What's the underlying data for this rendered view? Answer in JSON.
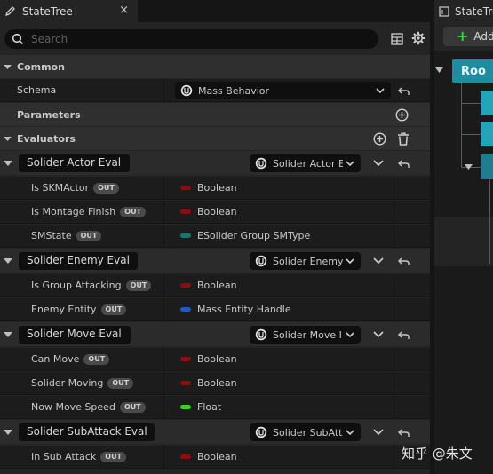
{
  "tab": {
    "title": "StateTree",
    "close": "×"
  },
  "search": {
    "placeholder": "Search"
  },
  "categories": {
    "common": "Common",
    "parameters": "Parameters",
    "evaluators": "Evaluators"
  },
  "schema": {
    "label": "Schema",
    "value": "Mass Behavior"
  },
  "evaluators": [
    {
      "name": "Solider Actor Eval",
      "class": "Solider Actor E",
      "props": [
        {
          "name": "Is SKMActor",
          "badge": "OUT",
          "type": "Boolean",
          "color": "#8b0d0d"
        },
        {
          "name": "Is Montage Finish",
          "badge": "OUT",
          "type": "Boolean",
          "color": "#8b0d0d"
        },
        {
          "name": "SMState",
          "badge": "OUT",
          "type": "ESolider Group SMType",
          "color": "#0c7a6f"
        }
      ]
    },
    {
      "name": "Solider Enemy Eval",
      "class": "Solider Enemy",
      "props": [
        {
          "name": "Is Group Attacking",
          "badge": "OUT",
          "type": "Boolean",
          "color": "#8b0d0d"
        },
        {
          "name": "Enemy Entity",
          "badge": "OUT",
          "type": "Mass Entity Handle",
          "color": "#1f59c4"
        }
      ]
    },
    {
      "name": "Solider Move Eval",
      "class": "Solider Move I",
      "props": [
        {
          "name": "Can Move",
          "badge": "OUT",
          "type": "Boolean",
          "color": "#8b0d0d"
        },
        {
          "name": "Solider Moving",
          "badge": "OUT",
          "type": "Boolean",
          "color": "#8b0d0d"
        },
        {
          "name": "Now Move Speed",
          "badge": "OUT",
          "type": "Float",
          "color": "#3ed321"
        }
      ]
    },
    {
      "name": "Solider SubAttack Eval",
      "class": "Solider SubAtt",
      "props": [
        {
          "name": "In Sub Attack",
          "badge": "OUT",
          "type": "Boolean",
          "color": "#8b0d0d"
        }
      ]
    }
  ],
  "right_panel": {
    "tab_title": "StateTre",
    "add_label": "Add",
    "root_label": "Roo"
  },
  "watermark": "知乎 @朱文",
  "colors": {
    "accent_teal": "#23a4b8",
    "root_teal": "#1e8da0",
    "add_green": "#3fd34a"
  }
}
